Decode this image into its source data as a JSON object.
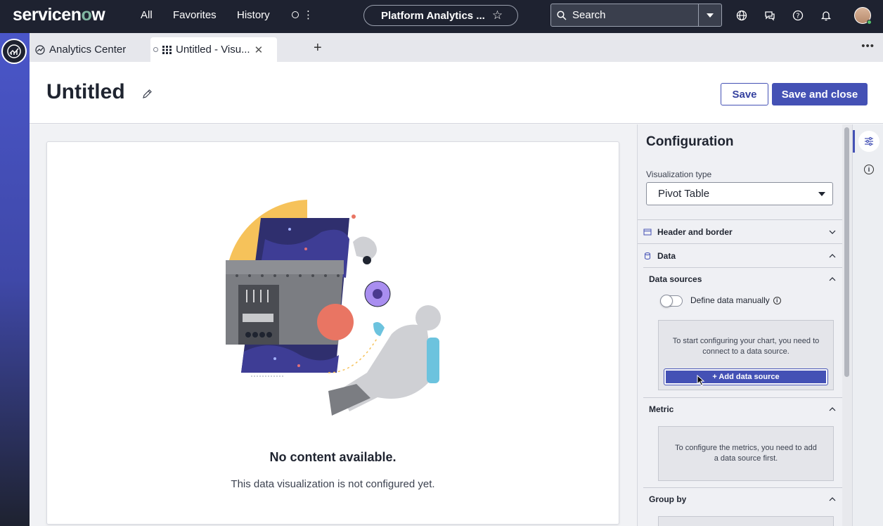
{
  "topnav": {
    "logo": "servicenow",
    "links": [
      "All",
      "Favorites",
      "History"
    ],
    "pill_title": "Platform Analytics ...",
    "search_placeholder": "Search"
  },
  "tabs": [
    {
      "label": "Analytics Center"
    },
    {
      "label": "Untitled - Visu..."
    }
  ],
  "header": {
    "title": "Untitled",
    "save_label": "Save",
    "save_close_label": "Save and close"
  },
  "canvas": {
    "empty_title": "No content available.",
    "empty_subtitle": "This data visualization is not configured yet."
  },
  "config": {
    "title": "Configuration",
    "viz_type_label": "Visualization type",
    "viz_type_value": "Pivot Table",
    "sections": {
      "header_border": "Header and border",
      "data": "Data",
      "data_sources": "Data sources",
      "define_manually": "Define data manually",
      "ds_message": "To start configuring your chart, you need to connect to a data source.",
      "add_ds": "+ Add data source",
      "metric": "Metric",
      "metric_message": "To configure the metrics, you need to add a data source first.",
      "group_by": "Group by"
    }
  },
  "colors": {
    "nav_bg": "#1e2230",
    "accent": "#4451b5",
    "rail": "#4a56c9"
  }
}
